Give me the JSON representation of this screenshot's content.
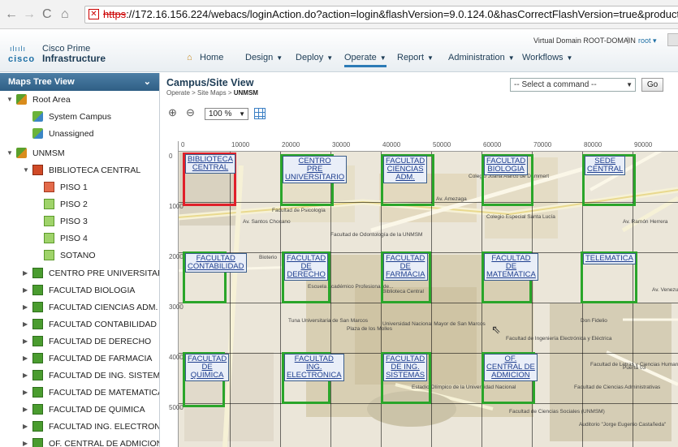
{
  "browser": {
    "url_proto": "https",
    "url_rest": "://172.16.156.224/webacs/loginAction.do?action=login&flashVersion=9.0.124.0&hasCorrectFlashVersion=true&product=w"
  },
  "header": {
    "logo_dots": "ılıılı",
    "logo_word": "cisco",
    "product_top": "Cisco Prime",
    "product_bottom": "Infrastructure",
    "virtual_domain": "Virtual Domain ROOT-DOMAIN",
    "separator": "|",
    "user": "root ▾",
    "menu": [
      {
        "label": "Home"
      },
      {
        "label": "Design"
      },
      {
        "label": "Deploy"
      },
      {
        "label": "Operate"
      },
      {
        "label": "Report"
      },
      {
        "label": "Administration"
      },
      {
        "label": "Workflows"
      }
    ]
  },
  "tree": {
    "title": "Maps Tree View",
    "nodes": [
      {
        "label": "Root Area"
      },
      {
        "label": "System Campus"
      },
      {
        "label": "Unassigned"
      },
      {
        "label": "UNMSM"
      },
      {
        "label": "BIBLIOTECA CENTRAL"
      },
      {
        "label": "PISO 1"
      },
      {
        "label": "PISO 2"
      },
      {
        "label": "PISO 3"
      },
      {
        "label": "PISO 4"
      },
      {
        "label": "SOTANO"
      },
      {
        "label": "CENTRO PRE UNIVERSITARI"
      },
      {
        "label": "FACULTAD BIOLOGIA"
      },
      {
        "label": "FACULTAD CIENCIAS ADM."
      },
      {
        "label": "FACULTAD CONTABILIDAD"
      },
      {
        "label": "FACULTAD DE DERECHO"
      },
      {
        "label": "FACULTAD DE FARMACIA"
      },
      {
        "label": "FACULTAD DE ING. SISTEM"
      },
      {
        "label": "FACULTAD DE MATEMATICA"
      },
      {
        "label": "FACULTAD DE QUIMICA"
      },
      {
        "label": "FACULTAD ING. ELECTRONI"
      },
      {
        "label": "OF. CENTRAL DE ADMICION"
      }
    ]
  },
  "main": {
    "title": "Campus/Site View",
    "breadcrumb_prefix": "Operate > Site Maps > ",
    "breadcrumb_current": "UNMSM",
    "command_select": "-- Select a command --",
    "go_button": "Go",
    "zoom": "100 %"
  },
  "map": {
    "ruler_x": [
      "0",
      "10000",
      "20000",
      "30000",
      "40000",
      "50000",
      "60000",
      "70000",
      "80000",
      "90000"
    ],
    "ruler_y": [
      "0",
      "1000",
      "2000",
      "3000",
      "4000",
      "5000"
    ],
    "zones": [
      {
        "label": "BIBLIOTECA CENTRAL",
        "l1": "BIBLIOTECA",
        "l2": "CENTRAL",
        "l3": "",
        "selected": true
      },
      {
        "label": "CENTRO PRE UNIVERSITARIO",
        "l1": "CENTRO",
        "l2": "PRE",
        "l3": "UNIVERSITARIO",
        "selected": false
      },
      {
        "label": "FACULTAD CIENCIAS ADM.",
        "l1": "FACULTAD",
        "l2": "CIENCIAS",
        "l3": "ADM.",
        "selected": false
      },
      {
        "label": "FACULTAD BIOLOGIA",
        "l1": "FACULTAD",
        "l2": "BIOLOGIA",
        "l3": "",
        "selected": false
      },
      {
        "label": "SEDE CENTRAL",
        "l1": "SEDE",
        "l2": "CENTRAL",
        "l3": "",
        "selected": false
      },
      {
        "label": "FACULTAD CONTABILIDAD",
        "l1": "FACULTAD",
        "l2": "CONTABILIDAD",
        "l3": "",
        "selected": false
      },
      {
        "label": "FACULTAD DE DERECHO",
        "l1": "FACULTAD",
        "l2": "DE",
        "l3": "DERECHO",
        "selected": false
      },
      {
        "label": "FACULTAD DE FARMACIA",
        "l1": "FACULTAD",
        "l2": "DE",
        "l3": "FARMACIA",
        "selected": false
      },
      {
        "label": "FACULTAD DE MATEMATICA",
        "l1": "FACULTAD",
        "l2": "DE",
        "l3": "MATEMATICA",
        "selected": false
      },
      {
        "label": "TELEMATICA",
        "l1": "TELEMATICA",
        "l2": "",
        "l3": "",
        "selected": false
      },
      {
        "label": "FACULTAD DE QUIMICA",
        "l1": "FACULTAD",
        "l2": "DE",
        "l3": "QUIMICA",
        "selected": false
      },
      {
        "label": "FACULTAD ING. ELECTRONICA",
        "l1": "FACULTAD",
        "l2": "ING.",
        "l3": "ELECTRONICA",
        "selected": false
      },
      {
        "label": "FACULTAD DE ING. SISTEMAS",
        "l1": "FACULTAD",
        "l2": "DE ING.",
        "l3": "SISTEMAS",
        "selected": false
      },
      {
        "label": "OF. CENTRAL DE ADMICION",
        "l1": "OF.",
        "l2": "CENTRAL DE",
        "l3": "ADMICION",
        "selected": false
      }
    ],
    "places": [
      "Facultad de Psicología",
      "Facultad de Odontología de la UNMSM",
      "Escuela Académico Profesional de...",
      "Biblioteca Central",
      "Universidad Nacional Mayor de San Marcos",
      "Plaza de los Molles",
      "Tuna Universitaria de San Marcos",
      "Colegio Especial Santa Lucía",
      "Colegio Juana Alarco de Dammert",
      "Don Fidelio",
      "Facultad de Ingeniería Electrónica y Eléctrica",
      "Facultad de Letras y Ciencias Humanas",
      "Estadio Olímpico de la Universidad Nacional",
      "Facultad de Ciencias Administrativas",
      "Facultad de Ciencias Sociales (UNMSM)",
      "Auditorio \"Jorge Eugenio Castañeda\"",
      "Puerta 03",
      "Av. Amezaga",
      "Av. Santos Chocano",
      "Av. Ramón Herrera",
      "Bioterio",
      "Av. Venezuela"
    ]
  }
}
